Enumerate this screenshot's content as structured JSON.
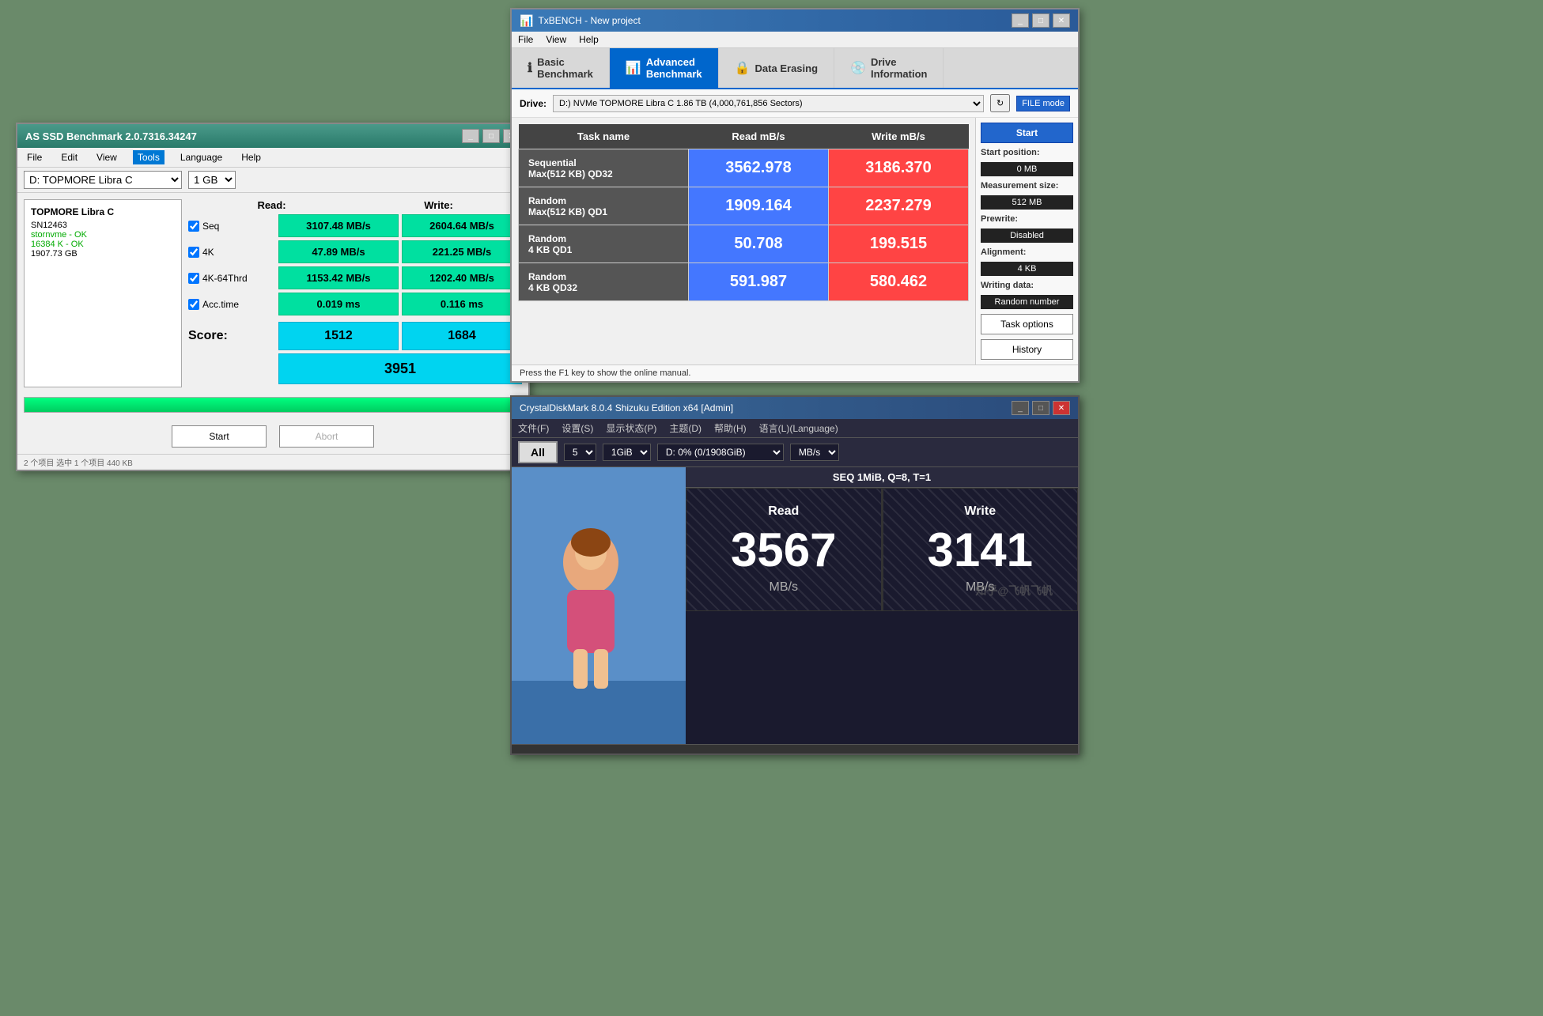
{
  "background_color": "#6a8a6a",
  "as_ssd": {
    "title": "AS SSD Benchmark 2.0.7316.34247",
    "menu": {
      "file": "File",
      "edit": "Edit",
      "view": "View",
      "tools": "Tools",
      "language": "Language",
      "help": "Help"
    },
    "drive_name": "D: TOPMORE Libra C",
    "drive_size": "1 GB",
    "info": {
      "model": "TOPMORE Libra C",
      "serial": "SN12463",
      "driver": "stornvme - OK",
      "block": "16384 K - OK",
      "capacity": "1907.73 GB"
    },
    "headers": {
      "test": "",
      "read": "Read:",
      "write": "Write:"
    },
    "results": [
      {
        "label": "Seq",
        "read": "3107.48 MB/s",
        "write": "2604.64 MB/s"
      },
      {
        "label": "4K",
        "read": "47.89 MB/s",
        "write": "221.25 MB/s"
      },
      {
        "label": "4K-64Thrd",
        "read": "1153.42 MB/s",
        "write": "1202.40 MB/s"
      },
      {
        "label": "Acc.time",
        "read": "0.019 ms",
        "write": "0.116 ms"
      }
    ],
    "scores": {
      "label": "Score:",
      "read": "1512",
      "write": "1684",
      "total": "3951"
    },
    "buttons": {
      "start": "Start",
      "abort": "Abort"
    },
    "statusbar": "2 个项目   选中 1 个项目   440 KB"
  },
  "txbench": {
    "title": "TxBENCH - New project",
    "menu": {
      "file": "File",
      "view": "View",
      "help": "Help"
    },
    "tabs": [
      {
        "label": "Basic\nBenchmark",
        "icon": "ℹ",
        "active": false
      },
      {
        "label": "Advanced\nBenchmark",
        "icon": "📊",
        "active": true
      },
      {
        "label": "Data Erasing",
        "icon": "🔒",
        "active": false
      },
      {
        "label": "Drive\nInformation",
        "icon": "💿",
        "active": false
      }
    ],
    "drive_label": "Drive:",
    "drive_value": "D:) NVMe TOPMORE Libra C  1.86 TB (4,000,761,856 Sectors)",
    "table": {
      "headers": [
        "Task name",
        "Read mB/s",
        "Write mB/s"
      ],
      "rows": [
        {
          "task": "Sequential\nMax(512 KB) QD32",
          "read": "3562.978",
          "write": "3186.370"
        },
        {
          "task": "Random\nMax(512 KB) QD1",
          "read": "1909.164",
          "write": "2237.279"
        },
        {
          "task": "Random\n4 KB QD1",
          "read": "50.708",
          "write": "199.515"
        },
        {
          "task": "Random\n4 KB QD32",
          "read": "591.987",
          "write": "580.462"
        }
      ]
    },
    "sidebar": {
      "start_btn": "Start",
      "start_position_label": "Start position:",
      "start_position_val": "0 MB",
      "measurement_size_label": "Measurement size:",
      "measurement_size_val": "512 MB",
      "prewrite_label": "Prewrite:",
      "prewrite_val": "Disabled",
      "alignment_label": "Alignment:",
      "alignment_val": "4 KB",
      "writing_data_label": "Writing data:",
      "writing_data_val": "Random number",
      "task_options_btn": "Task options",
      "history_btn": "History",
      "file_mode_btn": "FILE mode"
    },
    "status": "Press the F1 key to show the online manual."
  },
  "cdm": {
    "title": "CrystalDiskMark 8.0.4 Shizuku Edition x64 [Admin]",
    "menu": {
      "file": "文件(F)",
      "settings": "设置(S)",
      "display": "显示状态(P)",
      "theme": "主题(D)",
      "help": "帮助(H)",
      "language": "语言(L)(Language)"
    },
    "toolbar": {
      "all_btn": "All",
      "count": "5",
      "size": "1GiB",
      "drive": "D: 0% (0/1908GiB)",
      "unit": "MB/s"
    },
    "seq_label": "SEQ 1MiB, Q=8, T=1",
    "read_label": "Read",
    "write_label": "Write",
    "read_value": "3567",
    "write_value": "3141",
    "unit": "MB/s",
    "watermark": "知乎@飞帆飞帆"
  }
}
